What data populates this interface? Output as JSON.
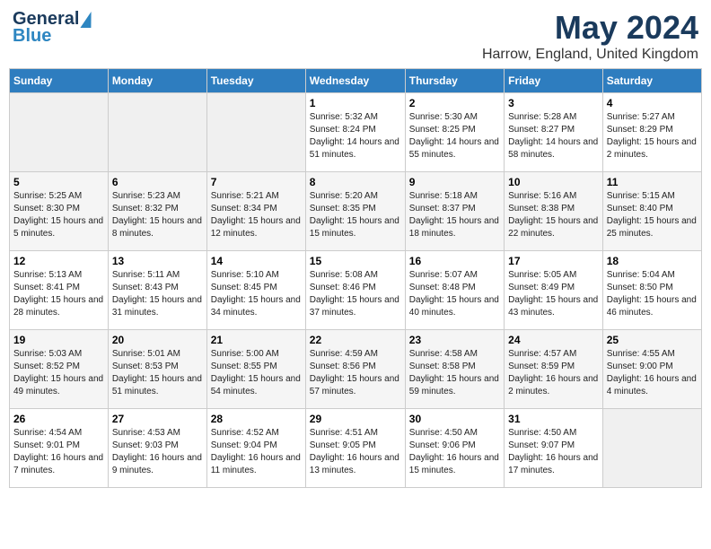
{
  "logo": {
    "line1": "General",
    "line2": "Blue"
  },
  "title": "May 2024",
  "location": "Harrow, England, United Kingdom",
  "days_of_week": [
    "Sunday",
    "Monday",
    "Tuesday",
    "Wednesday",
    "Thursday",
    "Friday",
    "Saturday"
  ],
  "weeks": [
    [
      {
        "day": "",
        "sunrise": "",
        "sunset": "",
        "daylight": ""
      },
      {
        "day": "",
        "sunrise": "",
        "sunset": "",
        "daylight": ""
      },
      {
        "day": "",
        "sunrise": "",
        "sunset": "",
        "daylight": ""
      },
      {
        "day": "1",
        "sunrise": "Sunrise: 5:32 AM",
        "sunset": "Sunset: 8:24 PM",
        "daylight": "Daylight: 14 hours and 51 minutes."
      },
      {
        "day": "2",
        "sunrise": "Sunrise: 5:30 AM",
        "sunset": "Sunset: 8:25 PM",
        "daylight": "Daylight: 14 hours and 55 minutes."
      },
      {
        "day": "3",
        "sunrise": "Sunrise: 5:28 AM",
        "sunset": "Sunset: 8:27 PM",
        "daylight": "Daylight: 14 hours and 58 minutes."
      },
      {
        "day": "4",
        "sunrise": "Sunrise: 5:27 AM",
        "sunset": "Sunset: 8:29 PM",
        "daylight": "Daylight: 15 hours and 2 minutes."
      }
    ],
    [
      {
        "day": "5",
        "sunrise": "Sunrise: 5:25 AM",
        "sunset": "Sunset: 8:30 PM",
        "daylight": "Daylight: 15 hours and 5 minutes."
      },
      {
        "day": "6",
        "sunrise": "Sunrise: 5:23 AM",
        "sunset": "Sunset: 8:32 PM",
        "daylight": "Daylight: 15 hours and 8 minutes."
      },
      {
        "day": "7",
        "sunrise": "Sunrise: 5:21 AM",
        "sunset": "Sunset: 8:34 PM",
        "daylight": "Daylight: 15 hours and 12 minutes."
      },
      {
        "day": "8",
        "sunrise": "Sunrise: 5:20 AM",
        "sunset": "Sunset: 8:35 PM",
        "daylight": "Daylight: 15 hours and 15 minutes."
      },
      {
        "day": "9",
        "sunrise": "Sunrise: 5:18 AM",
        "sunset": "Sunset: 8:37 PM",
        "daylight": "Daylight: 15 hours and 18 minutes."
      },
      {
        "day": "10",
        "sunrise": "Sunrise: 5:16 AM",
        "sunset": "Sunset: 8:38 PM",
        "daylight": "Daylight: 15 hours and 22 minutes."
      },
      {
        "day": "11",
        "sunrise": "Sunrise: 5:15 AM",
        "sunset": "Sunset: 8:40 PM",
        "daylight": "Daylight: 15 hours and 25 minutes."
      }
    ],
    [
      {
        "day": "12",
        "sunrise": "Sunrise: 5:13 AM",
        "sunset": "Sunset: 8:41 PM",
        "daylight": "Daylight: 15 hours and 28 minutes."
      },
      {
        "day": "13",
        "sunrise": "Sunrise: 5:11 AM",
        "sunset": "Sunset: 8:43 PM",
        "daylight": "Daylight: 15 hours and 31 minutes."
      },
      {
        "day": "14",
        "sunrise": "Sunrise: 5:10 AM",
        "sunset": "Sunset: 8:45 PM",
        "daylight": "Daylight: 15 hours and 34 minutes."
      },
      {
        "day": "15",
        "sunrise": "Sunrise: 5:08 AM",
        "sunset": "Sunset: 8:46 PM",
        "daylight": "Daylight: 15 hours and 37 minutes."
      },
      {
        "day": "16",
        "sunrise": "Sunrise: 5:07 AM",
        "sunset": "Sunset: 8:48 PM",
        "daylight": "Daylight: 15 hours and 40 minutes."
      },
      {
        "day": "17",
        "sunrise": "Sunrise: 5:05 AM",
        "sunset": "Sunset: 8:49 PM",
        "daylight": "Daylight: 15 hours and 43 minutes."
      },
      {
        "day": "18",
        "sunrise": "Sunrise: 5:04 AM",
        "sunset": "Sunset: 8:50 PM",
        "daylight": "Daylight: 15 hours and 46 minutes."
      }
    ],
    [
      {
        "day": "19",
        "sunrise": "Sunrise: 5:03 AM",
        "sunset": "Sunset: 8:52 PM",
        "daylight": "Daylight: 15 hours and 49 minutes."
      },
      {
        "day": "20",
        "sunrise": "Sunrise: 5:01 AM",
        "sunset": "Sunset: 8:53 PM",
        "daylight": "Daylight: 15 hours and 51 minutes."
      },
      {
        "day": "21",
        "sunrise": "Sunrise: 5:00 AM",
        "sunset": "Sunset: 8:55 PM",
        "daylight": "Daylight: 15 hours and 54 minutes."
      },
      {
        "day": "22",
        "sunrise": "Sunrise: 4:59 AM",
        "sunset": "Sunset: 8:56 PM",
        "daylight": "Daylight: 15 hours and 57 minutes."
      },
      {
        "day": "23",
        "sunrise": "Sunrise: 4:58 AM",
        "sunset": "Sunset: 8:58 PM",
        "daylight": "Daylight: 15 hours and 59 minutes."
      },
      {
        "day": "24",
        "sunrise": "Sunrise: 4:57 AM",
        "sunset": "Sunset: 8:59 PM",
        "daylight": "Daylight: 16 hours and 2 minutes."
      },
      {
        "day": "25",
        "sunrise": "Sunrise: 4:55 AM",
        "sunset": "Sunset: 9:00 PM",
        "daylight": "Daylight: 16 hours and 4 minutes."
      }
    ],
    [
      {
        "day": "26",
        "sunrise": "Sunrise: 4:54 AM",
        "sunset": "Sunset: 9:01 PM",
        "daylight": "Daylight: 16 hours and 7 minutes."
      },
      {
        "day": "27",
        "sunrise": "Sunrise: 4:53 AM",
        "sunset": "Sunset: 9:03 PM",
        "daylight": "Daylight: 16 hours and 9 minutes."
      },
      {
        "day": "28",
        "sunrise": "Sunrise: 4:52 AM",
        "sunset": "Sunset: 9:04 PM",
        "daylight": "Daylight: 16 hours and 11 minutes."
      },
      {
        "day": "29",
        "sunrise": "Sunrise: 4:51 AM",
        "sunset": "Sunset: 9:05 PM",
        "daylight": "Daylight: 16 hours and 13 minutes."
      },
      {
        "day": "30",
        "sunrise": "Sunrise: 4:50 AM",
        "sunset": "Sunset: 9:06 PM",
        "daylight": "Daylight: 16 hours and 15 minutes."
      },
      {
        "day": "31",
        "sunrise": "Sunrise: 4:50 AM",
        "sunset": "Sunset: 9:07 PM",
        "daylight": "Daylight: 16 hours and 17 minutes."
      },
      {
        "day": "",
        "sunrise": "",
        "sunset": "",
        "daylight": ""
      }
    ]
  ]
}
